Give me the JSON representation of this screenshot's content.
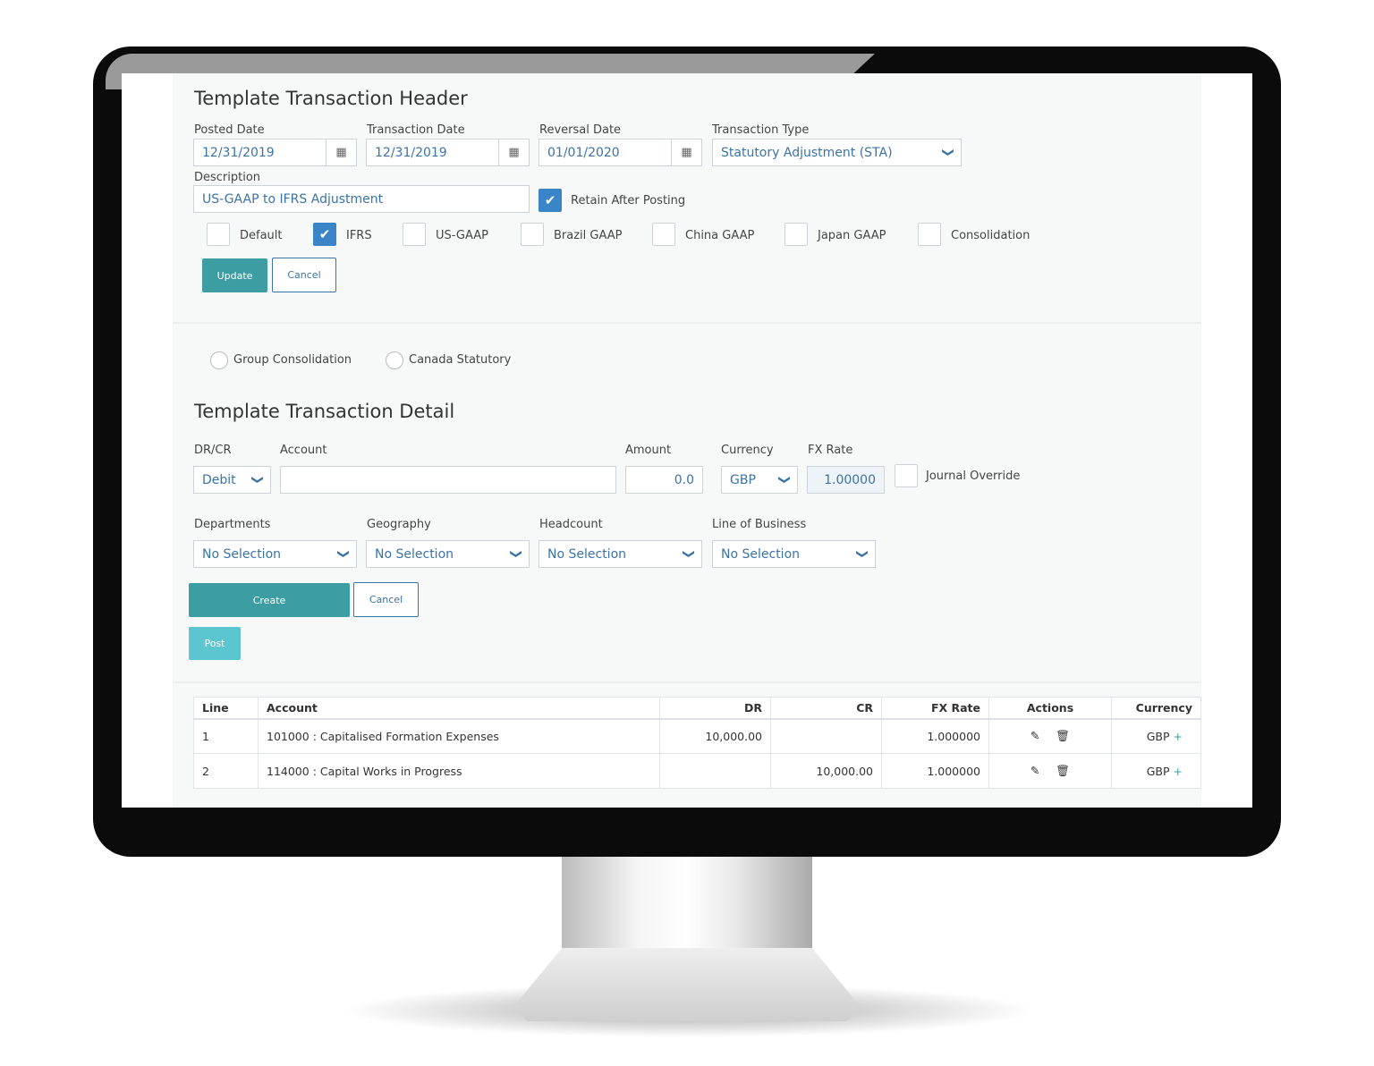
{
  "header": {
    "title": "Template Transaction Header",
    "posted_date": {
      "label": "Posted Date",
      "value": "12/31/2019"
    },
    "transaction_date": {
      "label": "Transaction Date",
      "value": "12/31/2019"
    },
    "reversal_date": {
      "label": "Reversal Date",
      "value": "01/01/2020"
    },
    "transaction_type": {
      "label": "Transaction Type",
      "value": "Statutory Adjustment (STA)"
    },
    "description": {
      "label": "Description",
      "value": "US-GAAP to IFRS Adjustment"
    },
    "retain_after_posting": {
      "label": "Retain After Posting",
      "checked": true
    },
    "ledgers": [
      {
        "label": "Default",
        "checked": false
      },
      {
        "label": "IFRS",
        "checked": true
      },
      {
        "label": "US-GAAP",
        "checked": false
      },
      {
        "label": "Brazil GAAP",
        "checked": false
      },
      {
        "label": "China GAAP",
        "checked": false
      },
      {
        "label": "Japan GAAP",
        "checked": false
      },
      {
        "label": "Consolidation",
        "checked": false
      }
    ],
    "update_label": "Update",
    "cancel_label": "Cancel"
  },
  "radios": [
    {
      "label": "Group Consolidation",
      "selected": false
    },
    {
      "label": "Canada Statutory",
      "selected": false
    }
  ],
  "detail": {
    "title": "Template Transaction Detail",
    "drcr": {
      "label": "DR/CR",
      "value": "Debit"
    },
    "account": {
      "label": "Account",
      "value": ""
    },
    "amount": {
      "label": "Amount",
      "value": "0.0"
    },
    "currency": {
      "label": "Currency",
      "value": "GBP"
    },
    "fx_rate": {
      "label": "FX Rate",
      "value": "1.00000"
    },
    "journal_override": {
      "label": "Journal Override",
      "checked": false
    },
    "departments": {
      "label": "Departments",
      "value": "No Selection"
    },
    "geography": {
      "label": "Geography",
      "value": "No Selection"
    },
    "headcount": {
      "label": "Headcount",
      "value": "No Selection"
    },
    "line_of_business": {
      "label": "Line of Business",
      "value": "No Selection"
    },
    "create_label": "Create",
    "cancel_label": "Cancel",
    "post_label": "Post"
  },
  "table": {
    "columns": [
      "Line",
      "Account",
      "DR",
      "CR",
      "FX Rate",
      "Actions",
      "Currency"
    ],
    "rows": [
      {
        "line": "1",
        "account": "101000 : Capitalised Formation Expenses",
        "dr": "10,000.00",
        "cr": "",
        "fx": "1.000000",
        "currency": "GBP"
      },
      {
        "line": "2",
        "account": "114000 : Capital Works in Progress",
        "dr": "",
        "cr": "10,000.00",
        "fx": "1.000000",
        "currency": "GBP"
      }
    ]
  },
  "colors": {
    "primary": "#3c9ea3",
    "post": "#5bc6d0",
    "link": "#3a73a8",
    "checkbox": "#3a85c8"
  }
}
